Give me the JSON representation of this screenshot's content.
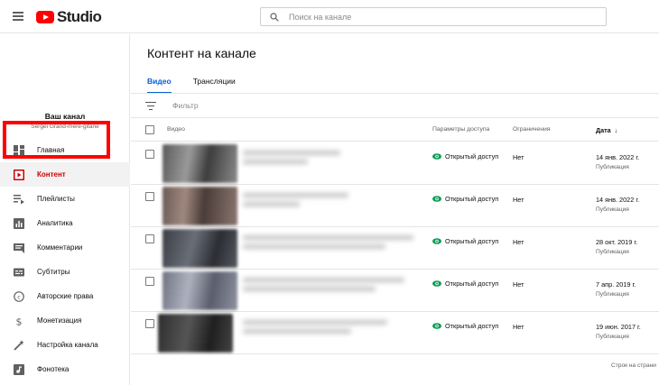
{
  "app": {
    "logo_text": "Studio"
  },
  "search": {
    "placeholder": "Поиск на канале"
  },
  "sidebar": {
    "channel_title": "Ваш канал",
    "channel_name": "Sergei Grand-mère-gitane",
    "items": [
      {
        "label": "Главная",
        "icon": "dashboard-icon"
      },
      {
        "label": "Контент",
        "icon": "content-icon",
        "active": true
      },
      {
        "label": "Плейлисты",
        "icon": "playlist-icon"
      },
      {
        "label": "Аналитика",
        "icon": "analytics-icon"
      },
      {
        "label": "Комментарии",
        "icon": "comments-icon"
      },
      {
        "label": "Субтитры",
        "icon": "subtitles-icon"
      },
      {
        "label": "Авторские права",
        "icon": "copyright-icon"
      },
      {
        "label": "Монетизация",
        "icon": "dollar-icon"
      },
      {
        "label": "Настройка канала",
        "icon": "wand-icon"
      },
      {
        "label": "Фонотека",
        "icon": "audio-library-icon"
      }
    ]
  },
  "main": {
    "title": "Контент на канале",
    "tabs": [
      {
        "label": "Видео",
        "active": true
      },
      {
        "label": "Трансляции"
      }
    ],
    "filter_placeholder": "Фильтр",
    "columns": {
      "video": "Видео",
      "visibility": "Параметры доступа",
      "restrictions": "Ограничения",
      "date": "Дата"
    },
    "rows": [
      {
        "visibility": "Открытый доступ",
        "restrictions": "Нет",
        "date": "14 янв. 2022 г.",
        "date_status": "Публикация"
      },
      {
        "visibility": "Открытый доступ",
        "restrictions": "Нет",
        "date": "14 янв. 2022 г.",
        "date_status": "Публикация"
      },
      {
        "visibility": "Открытый доступ",
        "restrictions": "Нет",
        "date": "28 окт. 2019 г.",
        "date_status": "Публикация"
      },
      {
        "visibility": "Открытый доступ",
        "restrictions": "Нет",
        "date": "7 апр. 2019 г.",
        "date_status": "Публикация"
      },
      {
        "visibility": "Открытый доступ",
        "restrictions": "Нет",
        "date": "19 июн. 2017 г.",
        "date_status": "Публикация"
      }
    ],
    "footer": "Строк на страни"
  },
  "colors": {
    "accent": "#065fd4",
    "brand": "#ff0000",
    "highlight": "#ff0000",
    "visibility_icon": "#0f9d58"
  }
}
